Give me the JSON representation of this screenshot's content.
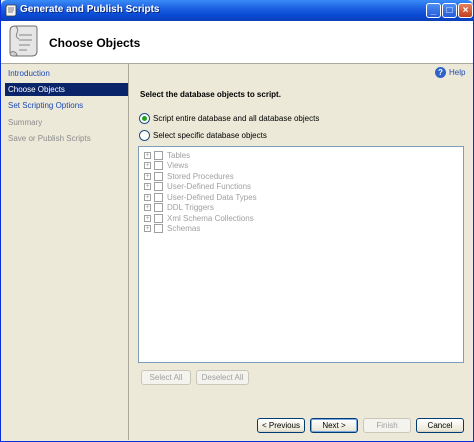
{
  "window": {
    "title": "Generate and Publish Scripts"
  },
  "header": {
    "title": "Choose Objects"
  },
  "nav": {
    "items": [
      {
        "label": "Introduction",
        "state": "link"
      },
      {
        "label": "Choose Objects",
        "state": "active"
      },
      {
        "label": "Set Scripting Options",
        "state": "link"
      },
      {
        "label": "Summary",
        "state": "disabled"
      },
      {
        "label": "Save or Publish Scripts",
        "state": "disabled"
      }
    ]
  },
  "help": {
    "label": "Help"
  },
  "instructions": "Select the database objects to script.",
  "options": {
    "entire": {
      "label": "Script entire database and all database objects",
      "selected": true
    },
    "specific": {
      "label": "Select specific database objects",
      "selected": false
    }
  },
  "tree": {
    "items": [
      "Tables",
      "Views",
      "Stored Procedures",
      "User-Defined Functions",
      "User-Defined Data Types",
      "DDL Triggers",
      "Xml Schema Collections",
      "Schemas"
    ]
  },
  "buttons": {
    "select_all": "Select All",
    "deselect_all": "Deselect All",
    "previous": "< Previous",
    "next": "Next >",
    "finish": "Finish",
    "cancel": "Cancel"
  },
  "colors": {
    "title_bar": "#0a4bd6",
    "nav_active": "#0a246a",
    "link": "#1b49b5"
  }
}
